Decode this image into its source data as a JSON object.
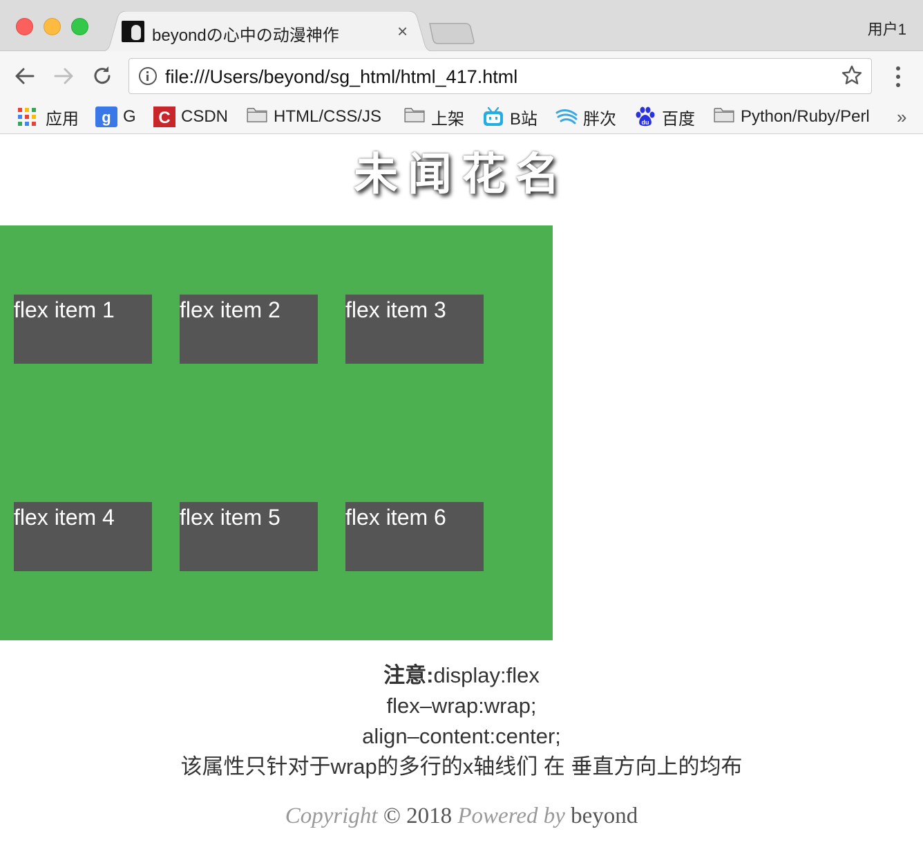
{
  "browser": {
    "tab_title": "beyondの心中の动漫神作",
    "tab_close": "×",
    "profile_label": "用户1",
    "url": "file:///Users/beyond/sg_html/html_417.html",
    "bookmarks": [
      {
        "label": "应用",
        "icon": "apps-grid-icon"
      },
      {
        "label": "G",
        "icon": "google-icon"
      },
      {
        "label": "CSDN",
        "icon": "csdn-icon"
      },
      {
        "label": "HTML/CSS/JS",
        "icon": "folder-icon"
      },
      {
        "label": "上架",
        "icon": "folder-icon"
      },
      {
        "label": "B站",
        "icon": "bilibili-icon"
      },
      {
        "label": "胖次",
        "icon": "wave-icon"
      },
      {
        "label": "百度",
        "icon": "baidu-icon"
      },
      {
        "label": "Python/Ruby/Perl",
        "icon": "folder-icon"
      }
    ],
    "bookmarks_more": "»"
  },
  "page": {
    "title": "未闻花名",
    "flex_items": [
      "flex item 1",
      "flex item 2",
      "flex item 3",
      "flex item 4",
      "flex item 5",
      "flex item 6"
    ],
    "note": {
      "label": "注意:",
      "line1": "display:flex",
      "line2": "flex–wrap:wrap;",
      "line3": "align–content:center;",
      "line4": "该属性只针对于wrap的多行的x轴线们 在 垂直方向上的均布"
    },
    "copyright": {
      "prefix": "Copyright",
      "symbol": "©",
      "year": "2018",
      "powered": "Powered by",
      "author": "beyond"
    }
  },
  "colors": {
    "container_bg": "#4caf50",
    "item_bg": "#555555",
    "item_text": "#ffffff",
    "title_text": "#ffffff"
  }
}
